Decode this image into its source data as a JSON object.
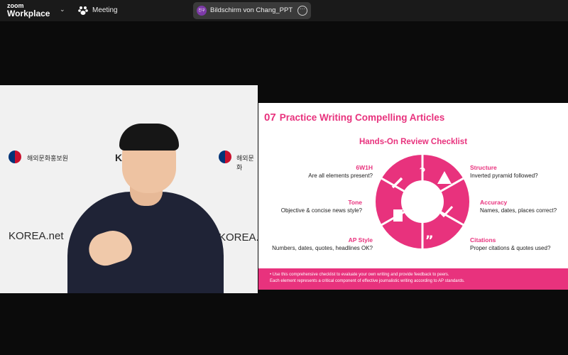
{
  "app": {
    "logo_line1": "zoom",
    "logo_line2": "Workplace",
    "meeting_label": "Meeting",
    "share": {
      "avatar_text": "친구",
      "label": "Bildschirm von Chang_PPT"
    }
  },
  "video": {
    "wall_text_1": "KOREA.net",
    "wall_text_2": "KO",
    "wall_text_3": "KOREA.net",
    "agency_1": "해외문화홍보원",
    "agency_2": "해외문화"
  },
  "slide": {
    "title_number": "07",
    "title": "Practice Writing Compelling Articles",
    "subtitle": "Hands-On Review Checklist",
    "items": [
      {
        "heading": "6W1H",
        "text": "Are all elements present?"
      },
      {
        "heading": "Tone",
        "text": "Objective & concise news style?"
      },
      {
        "heading": "AP Style",
        "text": "Numbers, dates, quotes, headlines OK?"
      },
      {
        "heading": "Structure",
        "text": "Inverted pyramid followed?"
      },
      {
        "heading": "Accuracy",
        "text": "Names, dates, places correct?"
      },
      {
        "heading": "Citations",
        "text": "Proper citations & quotes used?"
      }
    ],
    "footer_line1": "• Use this comprehensive checklist to evaluate your own writing and provide feedback to peers.",
    "footer_line2": "Each element represents a critical component of effective journalistic writing according to AP standards.",
    "accent_color": "#e8327d"
  }
}
